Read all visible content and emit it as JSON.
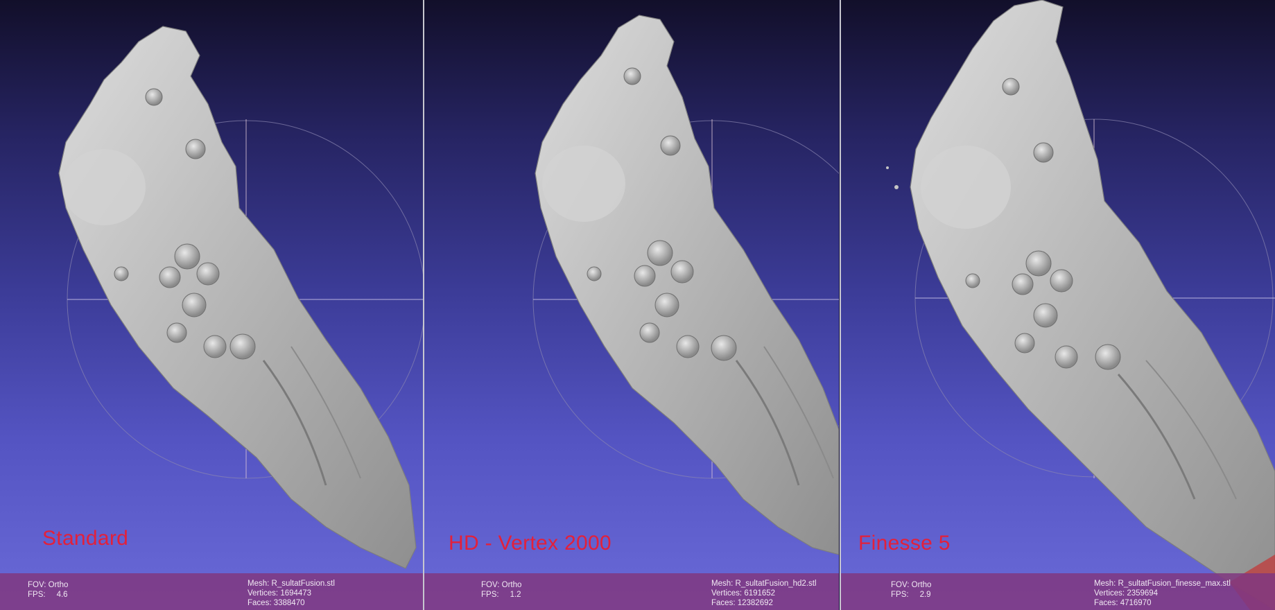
{
  "panels": [
    {
      "caption": "Standard",
      "fov_label": "FOV:",
      "fov_value": "Ortho",
      "fps_label": "FPS:",
      "fps_value": "4.6",
      "mesh_label": "Mesh:",
      "mesh_value": "R_sultatFusion.stl",
      "vertices_label": "Vertices:",
      "vertices_value": "1694473",
      "faces_label": "Faces:",
      "faces_value": "3388470"
    },
    {
      "caption": "HD - Vertex 2000",
      "fov_label": "FOV:",
      "fov_value": "Ortho",
      "fps_label": "FPS:",
      "fps_value": "1.2",
      "mesh_label": "Mesh:",
      "mesh_value": "R_sultatFusion_hd2.stl",
      "vertices_label": "Vertices:",
      "vertices_value": "6191652",
      "faces_label": "Faces:",
      "faces_value": "12382692"
    },
    {
      "caption": "Finesse 5",
      "fov_label": "FOV:",
      "fov_value": "Ortho",
      "fps_label": "FPS:",
      "fps_value": "2.9",
      "mesh_label": "Mesh:",
      "mesh_value": "R_sultatFusion_finesse_max.stl",
      "vertices_label": "Vertices:",
      "vertices_value": "2359694",
      "faces_label": "Faces:",
      "faces_value": "4716970"
    }
  ],
  "colors": {
    "background_top": "#120f2a",
    "background_bottom": "#6a6ad8",
    "caption": "#e3203a",
    "infobar": "#803880",
    "mesh": "#b8b8b8"
  },
  "icons": [
    "trackball-gizmo-icon",
    "mesh-model-icon"
  ]
}
